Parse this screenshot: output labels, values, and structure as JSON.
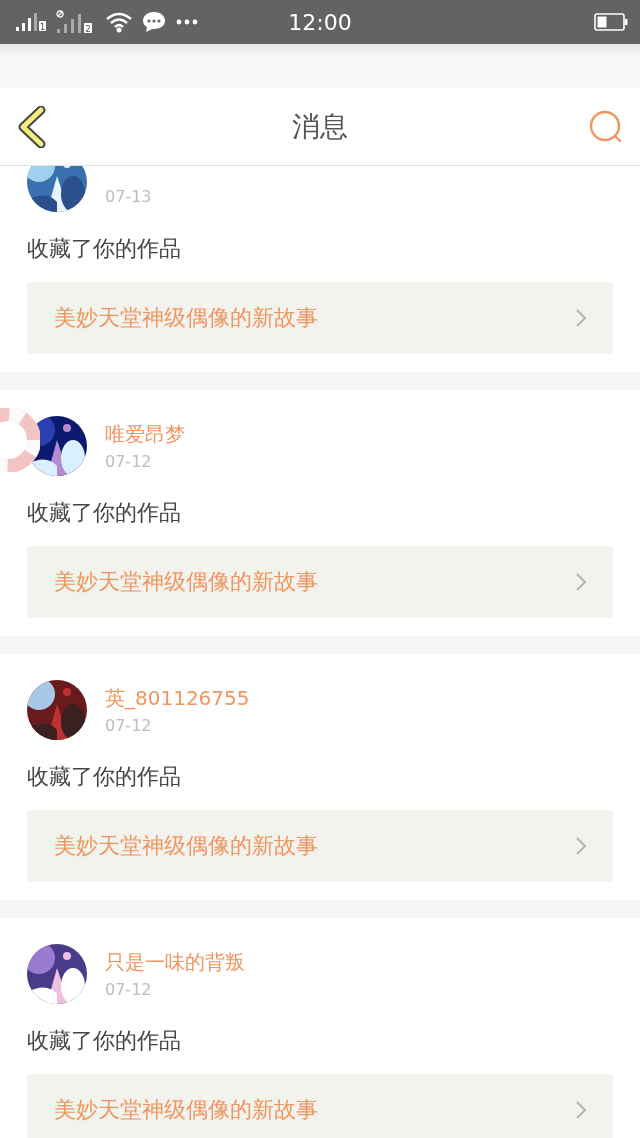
{
  "status_bar": {
    "sim_labels": [
      "1",
      "2"
    ],
    "time": "12:00"
  },
  "header": {
    "title": "消息"
  },
  "messages": [
    {
      "date": "07-13",
      "action": "收藏了你的作品",
      "work": "美妙天堂神级偶像的新故事"
    },
    {
      "name": "唯爱昂梦",
      "date": "07-12",
      "action": "收藏了你的作品",
      "work": "美妙天堂神级偶像的新故事"
    },
    {
      "name": "英_801126755",
      "date": "07-12",
      "action": "收藏了你的作品",
      "work": "美妙天堂神级偶像的新故事"
    },
    {
      "name": "只是一味的背叛",
      "date": "07-12",
      "action": "收藏了你的作品",
      "work": "美妙天堂神级偶像的新故事"
    }
  ]
}
